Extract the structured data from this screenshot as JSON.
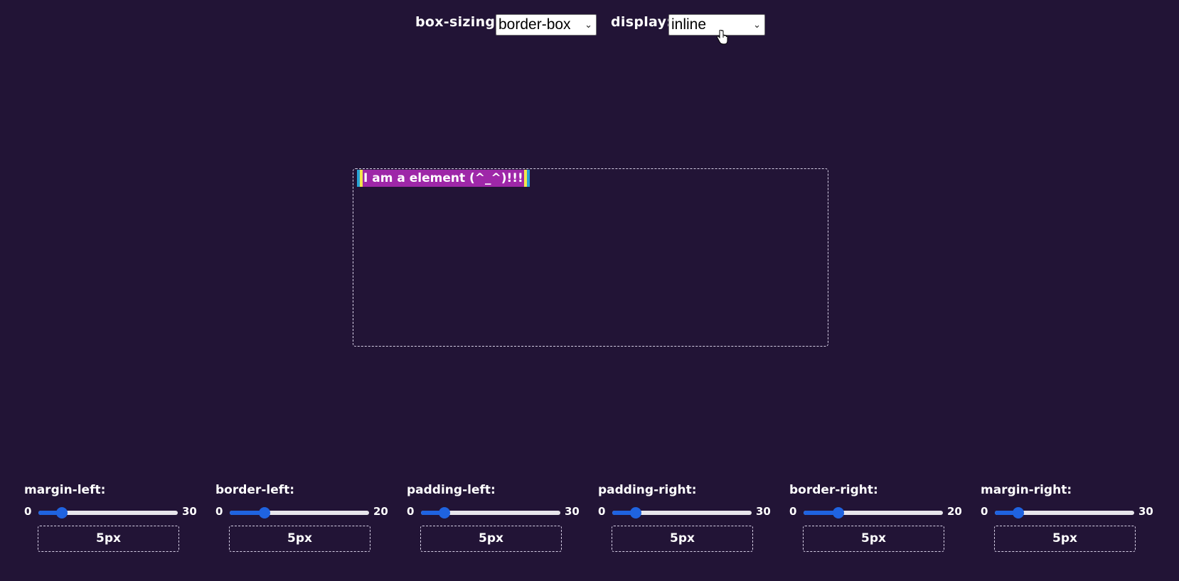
{
  "toolbar": {
    "box_sizing_label": "box-sizing:",
    "box_sizing_value": "border-box",
    "display_label": "display:",
    "display_value": "inline"
  },
  "element": {
    "text": "I am a element (^_^)!!!"
  },
  "colors": {
    "background": "#221436",
    "element_content": "#9e27a8",
    "border_outer": "#27a3d6",
    "border_inner": "#f2e64a",
    "slider_accent": "#1f63e0"
  },
  "controls": [
    {
      "label": "margin-left:",
      "min": "0",
      "max": "30",
      "value": 5,
      "display": "5px"
    },
    {
      "label": "border-left:",
      "min": "0",
      "max": "20",
      "value": 5,
      "display": "5px"
    },
    {
      "label": "padding-left:",
      "min": "0",
      "max": "30",
      "value": 5,
      "display": "5px"
    },
    {
      "label": "padding-right:",
      "min": "0",
      "max": "30",
      "value": 5,
      "display": "5px"
    },
    {
      "label": "border-right:",
      "min": "0",
      "max": "20",
      "value": 5,
      "display": "5px"
    },
    {
      "label": "margin-right:",
      "min": "0",
      "max": "30",
      "value": 5,
      "display": "5px"
    }
  ]
}
